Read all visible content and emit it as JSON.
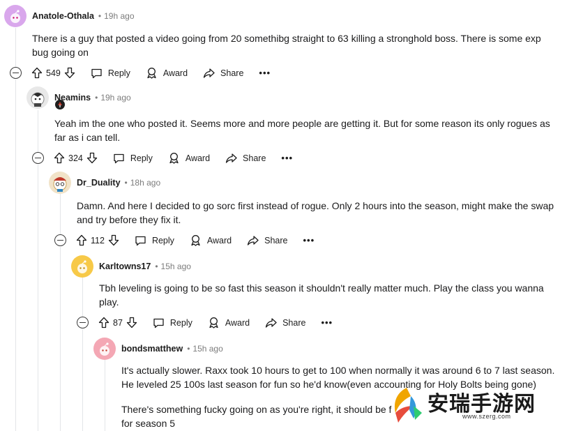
{
  "comments": [
    {
      "username": "Anatole-Othala",
      "time": "19h ago",
      "body": [
        "There is a guy that posted a video going from 20 somethibg straight to 63 killing a stronghold boss. There is some exp bug going on"
      ],
      "votes": "549",
      "avatar_color": "#d9a7ec"
    },
    {
      "username": "Neamins",
      "time": "19h ago",
      "body": [
        "Yeah im the one who posted it. Seems more and more people are getting it. But for some reason its only rogues as far as i can tell."
      ],
      "votes": "324",
      "avatar_color": "#e8e8e8"
    },
    {
      "username": "Dr_Duality",
      "time": "18h ago",
      "body": [
        "Damn. And here I decided to go sorc first instead of rogue. Only 2 hours into the season, might make the swap and try before they fix it."
      ],
      "votes": "112",
      "avatar_color": "#f1e3c8"
    },
    {
      "username": "Karltowns17",
      "time": "15h ago",
      "body": [
        "Tbh leveling is going to be so fast this season it shouldn't really matter much. Play the class you wanna play."
      ],
      "votes": "87",
      "avatar_color": "#f7c948"
    },
    {
      "username": "bondsmatthew",
      "time": "15h ago",
      "body": [
        "It's actually slower. Raxx took 10 hours to get to 100 when normally it was around 6 to 7 last season. He leveled 25 100s last season for fun so he'd know(even accounting for Holy Bolts being gone)",
        "There's something fucky going on as you're right, it should be f",
        "for season 5"
      ],
      "avatar_color": "#f4a7b4"
    }
  ],
  "actions": {
    "reply": "Reply",
    "award": "Award",
    "share": "Share",
    "more": "•••"
  },
  "watermark": {
    "text": "安瑞手游网",
    "url": "www.szerg.com"
  }
}
